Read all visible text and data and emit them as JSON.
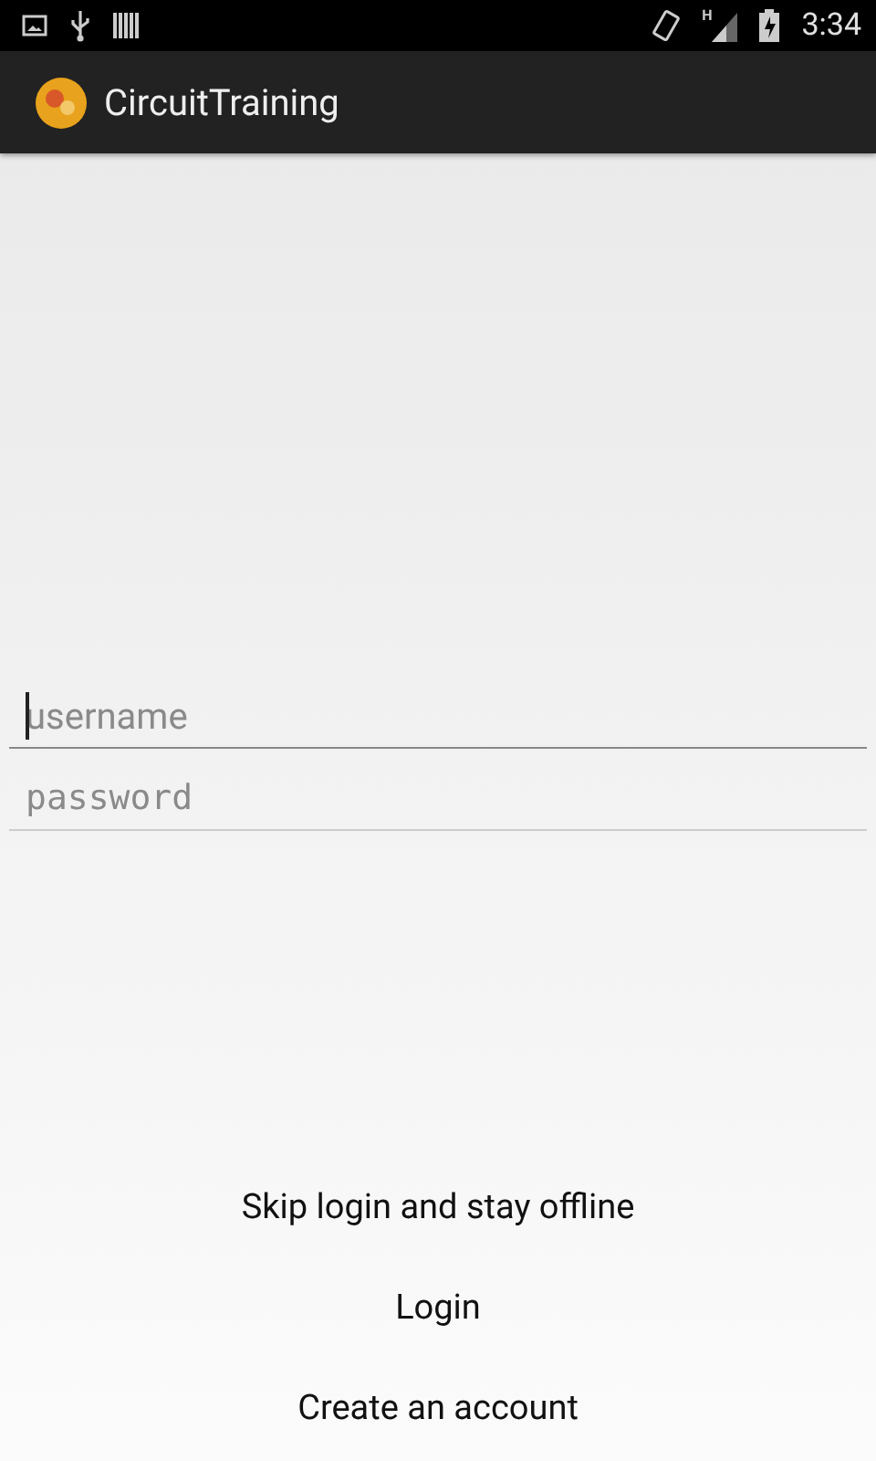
{
  "status_bar": {
    "network_type": "H",
    "time": "3:34"
  },
  "action_bar": {
    "title": "CircuitTraining"
  },
  "fields": [
    {
      "kind": "text",
      "placeholder": "username",
      "focused": true
    },
    {
      "kind": "password",
      "placeholder": "password",
      "focused": false
    }
  ],
  "buttons": [
    "Skip login and stay offline",
    "Login",
    "Create an account"
  ]
}
